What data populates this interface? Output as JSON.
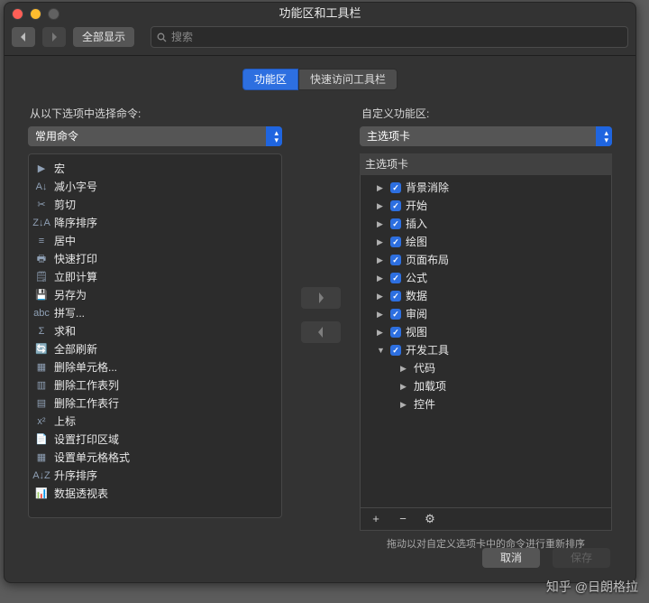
{
  "window": {
    "title": "功能区和工具栏"
  },
  "toolbar": {
    "show_all": "全部显示",
    "search_placeholder": "搜索"
  },
  "tabs": [
    {
      "id": "ribbon",
      "label": "功能区",
      "active": true
    },
    {
      "id": "qat",
      "label": "快速访问工具栏",
      "active": false
    }
  ],
  "left": {
    "caption": "从以下选项中选择命令:",
    "dropdown": "常用命令",
    "items": [
      {
        "icon": "▶",
        "label": "宏"
      },
      {
        "icon": "A↓",
        "label": "减小字号"
      },
      {
        "icon": "✂",
        "label": "剪切"
      },
      {
        "icon": "Z↓A",
        "label": "降序排序"
      },
      {
        "icon": "≡",
        "label": "居中"
      },
      {
        "icon": "🖶",
        "label": "快速打印"
      },
      {
        "icon": "🗒",
        "label": "立即计算"
      },
      {
        "icon": "💾",
        "label": "另存为"
      },
      {
        "icon": "abc",
        "label": "拼写..."
      },
      {
        "icon": "Σ",
        "label": "求和"
      },
      {
        "icon": "🔄",
        "label": "全部刷新"
      },
      {
        "icon": "▦",
        "label": "删除单元格..."
      },
      {
        "icon": "▥",
        "label": "删除工作表列"
      },
      {
        "icon": "▤",
        "label": "删除工作表行"
      },
      {
        "icon": "x²",
        "label": "上标"
      },
      {
        "icon": "📄",
        "label": "设置打印区域"
      },
      {
        "icon": "▦",
        "label": "设置单元格格式"
      },
      {
        "icon": "A↓Z",
        "label": "升序排序"
      },
      {
        "icon": "📊",
        "label": "数据透视表"
      }
    ]
  },
  "middle": {
    "add_disabled": true,
    "remove_disabled": true
  },
  "right": {
    "caption": "自定义功能区:",
    "dropdown": "主选项卡",
    "group_header": "主选项卡",
    "tabs": [
      {
        "label": "背景消除",
        "open": false,
        "checked": true
      },
      {
        "label": "开始",
        "open": false,
        "checked": true
      },
      {
        "label": "插入",
        "open": false,
        "checked": true
      },
      {
        "label": "绘图",
        "open": false,
        "checked": true
      },
      {
        "label": "页面布局",
        "open": false,
        "checked": true
      },
      {
        "label": "公式",
        "open": false,
        "checked": true
      },
      {
        "label": "数据",
        "open": false,
        "checked": true
      },
      {
        "label": "审阅",
        "open": false,
        "checked": true
      },
      {
        "label": "视图",
        "open": false,
        "checked": true
      },
      {
        "label": "开发工具",
        "open": true,
        "checked": true,
        "children": [
          {
            "label": "代码"
          },
          {
            "label": "加载项"
          },
          {
            "label": "控件"
          }
        ]
      }
    ],
    "toolbar": {
      "add": "+",
      "remove": "−",
      "settings": "⚙"
    },
    "hint": "拖动以对自定义选项卡中的命令进行重新排序"
  },
  "footer": {
    "cancel": "取消",
    "save": "保存"
  },
  "watermark": "知乎 @日朗格拉"
}
